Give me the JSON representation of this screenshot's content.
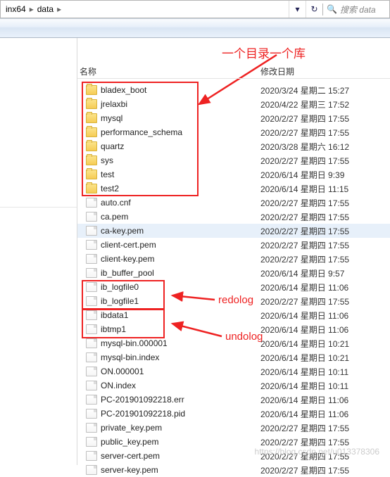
{
  "breadcrumb": {
    "seg1": "inx64",
    "seg2": "data"
  },
  "search": {
    "placeholder": "搜索 data"
  },
  "annotation": {
    "top": "一个目录一个库",
    "redo": "redolog",
    "undo": "undolog"
  },
  "header": {
    "name": "名称",
    "date": "修改日期"
  },
  "rows": [
    {
      "type": "folder",
      "name": "bladex_boot",
      "date": "2020/3/24 星期二 15:27"
    },
    {
      "type": "folder",
      "name": "jrelaxbi",
      "date": "2020/4/22 星期三 17:52"
    },
    {
      "type": "folder",
      "name": "mysql",
      "date": "2020/2/27 星期四 17:55"
    },
    {
      "type": "folder",
      "name": "performance_schema",
      "date": "2020/2/27 星期四 17:55"
    },
    {
      "type": "folder",
      "name": "quartz",
      "date": "2020/3/28 星期六 16:12"
    },
    {
      "type": "folder",
      "name": "sys",
      "date": "2020/2/27 星期四 17:55"
    },
    {
      "type": "folder",
      "name": "test",
      "date": "2020/6/14 星期日 9:39"
    },
    {
      "type": "folder",
      "name": "test2",
      "date": "2020/6/14 星期日 11:15"
    },
    {
      "type": "file",
      "name": "auto.cnf",
      "date": "2020/2/27 星期四 17:55"
    },
    {
      "type": "file",
      "name": "ca.pem",
      "date": "2020/2/27 星期四 17:55"
    },
    {
      "type": "file",
      "name": "ca-key.pem",
      "date": "2020/2/27 星期四 17:55",
      "hl": true
    },
    {
      "type": "file",
      "name": "client-cert.pem",
      "date": "2020/2/27 星期四 17:55"
    },
    {
      "type": "file",
      "name": "client-key.pem",
      "date": "2020/2/27 星期四 17:55"
    },
    {
      "type": "file",
      "name": "ib_buffer_pool",
      "date": "2020/6/14 星期日 9:57"
    },
    {
      "type": "file",
      "name": "ib_logfile0",
      "date": "2020/6/14 星期日 11:06"
    },
    {
      "type": "file",
      "name": "ib_logfile1",
      "date": "2020/2/27 星期四 17:55"
    },
    {
      "type": "file",
      "name": "ibdata1",
      "date": "2020/6/14 星期日 11:06"
    },
    {
      "type": "file",
      "name": "ibtmp1",
      "date": "2020/6/14 星期日 11:06"
    },
    {
      "type": "file",
      "name": "mysql-bin.000001",
      "date": "2020/6/14 星期日 10:21"
    },
    {
      "type": "file",
      "name": "mysql-bin.index",
      "date": "2020/6/14 星期日 10:21"
    },
    {
      "type": "file",
      "name": "ON.000001",
      "date": "2020/6/14 星期日 10:11"
    },
    {
      "type": "file",
      "name": "ON.index",
      "date": "2020/6/14 星期日 10:11"
    },
    {
      "type": "file",
      "name": "PC-201901092218.err",
      "date": "2020/6/14 星期日 11:06"
    },
    {
      "type": "file",
      "name": "PC-201901092218.pid",
      "date": "2020/6/14 星期日 11:06"
    },
    {
      "type": "file",
      "name": "private_key.pem",
      "date": "2020/2/27 星期四 17:55"
    },
    {
      "type": "file",
      "name": "public_key.pem",
      "date": "2020/2/27 星期四 17:55"
    },
    {
      "type": "file",
      "name": "server-cert.pem",
      "date": "2020/2/27 星期四 17:55"
    },
    {
      "type": "file",
      "name": "server-key.pem",
      "date": "2020/2/27 星期四 17:55"
    }
  ],
  "watermark": "https://blog.csdn.net/u013378306"
}
